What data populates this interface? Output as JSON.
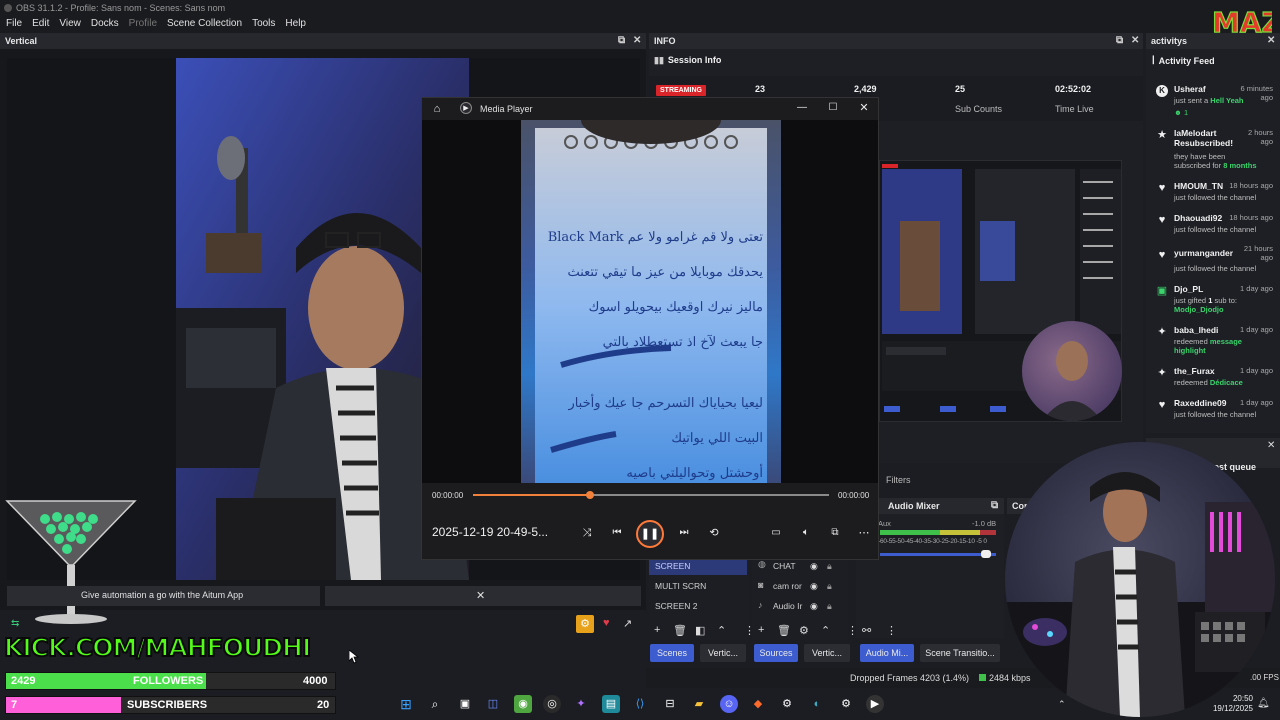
{
  "window": {
    "title": "OBS 31.1.2 - Profile: Sans nom - Scenes: Sans nom"
  },
  "menu": {
    "file": "File",
    "edit": "Edit",
    "view": "View",
    "docks": "Docks",
    "profile": "Profile",
    "scene_collection": "Scene Collection",
    "tools": "Tools",
    "help": "Help"
  },
  "vertical_dock": {
    "title": "Vertical",
    "popout_icon": "popout-icon",
    "close_icon": "close-icon"
  },
  "info_dock": {
    "title": "INFO",
    "session_title": "Session Info",
    "streaming_badge": "STREAMING",
    "stat1_value": "23",
    "stat2_value": "2,429",
    "stat2_label": "ers",
    "stat3_value": "25",
    "stat3_label": "Sub Counts",
    "stat4_value": "02:52:02",
    "stat4_label": "Time Live"
  },
  "activity_dock": {
    "title": "activitys",
    "feed_title": "Activity Feed",
    "items": [
      {
        "icon": "kick-icon",
        "name": "Usheraf",
        "time": "6 minutes ago",
        "desc_pre": "just sent a ",
        "desc_hl": "Hell Yeah",
        "desc_post": "",
        "extra": "1"
      },
      {
        "icon": "star-icon",
        "name": "laMelodart Resubscribed!",
        "time": "2 hours ago",
        "desc_pre": "they have been subscribed for ",
        "desc_hl": "8 months",
        "desc_post": ""
      },
      {
        "icon": "heart-icon",
        "name": "HMOUM_TN",
        "time": "18 hours ago",
        "desc_pre": "just followed the channel",
        "desc_hl": "",
        "desc_post": ""
      },
      {
        "icon": "heart-icon",
        "name": "Dhaouadi92",
        "time": "18 hours ago",
        "desc_pre": "just followed the channel",
        "desc_hl": "",
        "desc_post": ""
      },
      {
        "icon": "heart-icon",
        "name": "yurmangander",
        "time": "21 hours ago",
        "desc_pre": "just followed the channel",
        "desc_hl": "",
        "desc_post": ""
      },
      {
        "icon": "gift-icon",
        "name": "Djo_PL",
        "time": "1 day ago",
        "desc_pre": "just gifted ",
        "desc_hl": "1",
        "desc_post": " sub to:",
        "desc_line2": "Modjo_Djodjo"
      },
      {
        "icon": "star-icon",
        "name": "baba_lhedi",
        "time": "1 day ago",
        "desc_pre": "redeemed ",
        "desc_hl": "message highlight",
        "desc_post": ""
      },
      {
        "icon": "star-icon",
        "name": "the_Furax",
        "time": "1 day ago",
        "desc_pre": "redeemed ",
        "desc_hl": "Dédicace",
        "desc_post": ""
      },
      {
        "icon": "heart-icon",
        "name": "Raxeddine09",
        "time": "1 day ago",
        "desc_pre": "just followed the channel",
        "desc_hl": "",
        "desc_post": ""
      }
    ]
  },
  "media_player": {
    "title": "Media Player",
    "time_start": "00:00:00",
    "time_end": "00:00:00",
    "progress": 0.33,
    "file_name": "2025-12-19 20-49-5...",
    "icons": [
      "home-icon",
      "shuffle-icon",
      "previous-icon",
      "pause-icon",
      "next-icon",
      "repeat-icon",
      "subtitles-icon",
      "volume-icon",
      "miniplayer-icon",
      "more-icon"
    ]
  },
  "notification": {
    "text": "Give automation a go with the Aitum App"
  },
  "scenes": {
    "items": [
      "SCREEN",
      "MULTI SCRN",
      "SCREEN 2"
    ]
  },
  "sources": {
    "items": [
      "CHAT",
      "cam ror",
      "Audio Ir"
    ]
  },
  "filters_label": "Filters",
  "audio_mixer": {
    "title": "Audio Mixer",
    "channel": "Aux",
    "db": "-1.0 dB",
    "scale": "-60-55-50-45-40-35-30-25-20-15-10 -5 0"
  },
  "controls_label": "Con",
  "queue_label": "est queue",
  "tabs": {
    "scenes": "Scenes",
    "vertical1": "Vertic...",
    "sources": "Sources",
    "vertical2": "Vertic...",
    "audio_mixer": "Audio Mi...",
    "scene_transitions": "Scene Transitio..."
  },
  "status": {
    "dropped": "Dropped Frames 4203 (1.4%)",
    "bitrate": "2484 kbps",
    "fps": ".00 FPS"
  },
  "overlay": {
    "kick_text": "KICK.COM/MAHFOUDHI",
    "followers_count": "2429",
    "followers_label": "FOLLOWERS",
    "followers_goal": "4000",
    "followers_progress": 0.607,
    "subs_count": "7",
    "subs_label": "SUBSCRIBERS",
    "subs_goal": "20",
    "subs_progress": 0.35,
    "logo_text": "MAZ"
  },
  "clock": {
    "time": "20:50",
    "date": "19/12/2025"
  },
  "notepad_lines": [
    "تعتى ولا قم غرامو ولا عم Black Mark",
    "يحدقك موبايلا من عيز ما تيقي تتعنث",
    "ماليز نيرك اوقعيك بيحويلو اسوك",
    "جا يبعث لآخ اذ تستعطلاد بالتي",
    "ليعيا بحياياك التسرحم جا عيك وأخبار",
    "البيت اللي يواتيك",
    "أوحشتل وتحواليلتي باصيه"
  ],
  "colors": {
    "accent": "#3c5ccf",
    "streaming": "#d9252a",
    "kick_green": "#53fc18",
    "followers_bar": "#4be04b",
    "subs_bar": "#ff5fd8"
  }
}
